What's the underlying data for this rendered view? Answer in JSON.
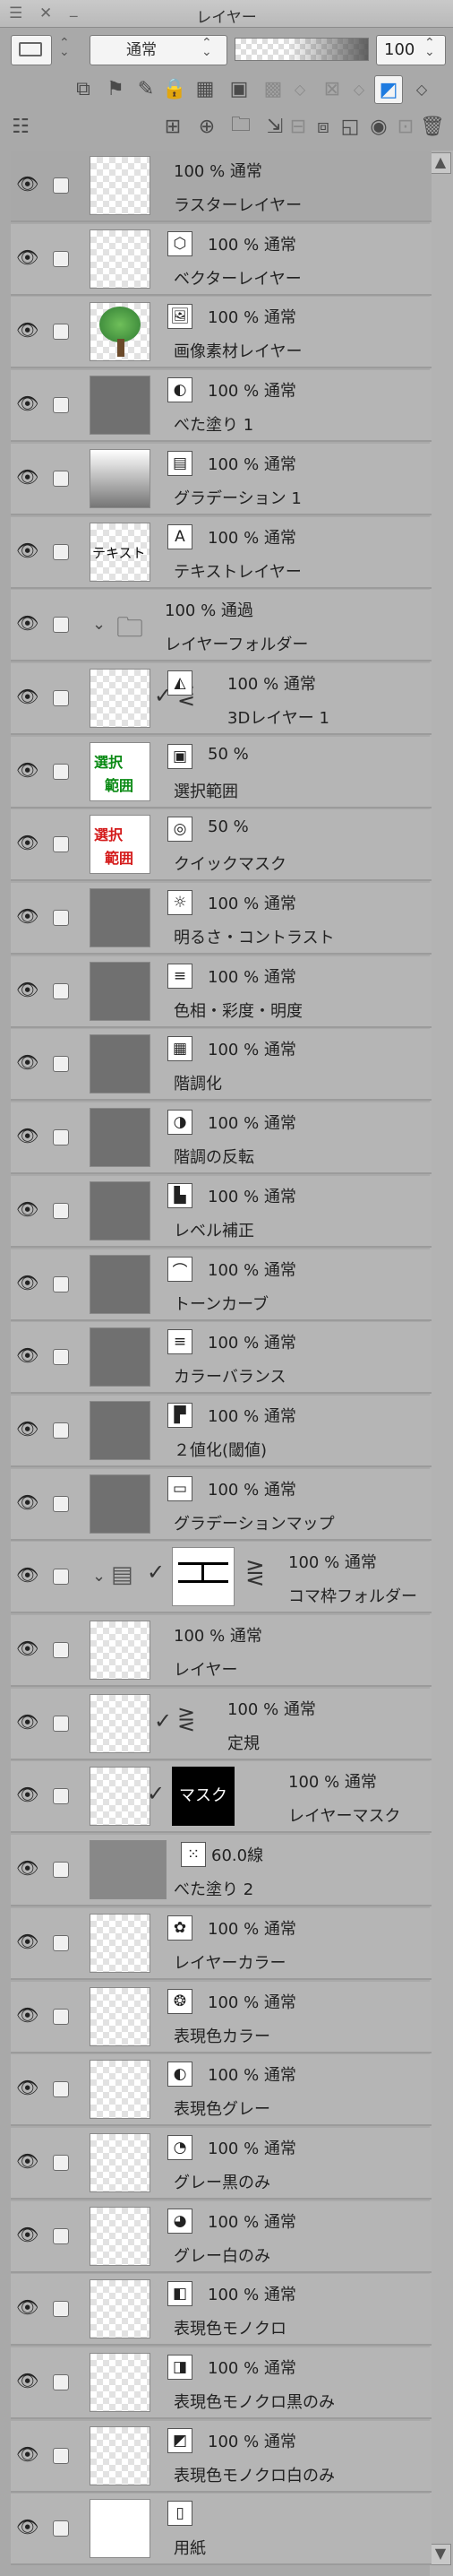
{
  "panel": {
    "title": "レイヤー"
  },
  "blend": {
    "mode": "通常",
    "opacity": "100"
  },
  "layers": [
    {
      "opacity": "100 %  通常",
      "name": "ラスターレイヤー",
      "thumb": "checker",
      "badge": ""
    },
    {
      "opacity": "100 %  通常",
      "name": "ベクターレイヤー",
      "thumb": "checker",
      "badge": "cube-icon"
    },
    {
      "opacity": "100 %  通常",
      "name": "画像素材レイヤー",
      "thumb": "tree",
      "badge": "image-icon"
    },
    {
      "opacity": "100 %  通常",
      "name": "べた塗り 1",
      "thumb": "gray",
      "badge": "fill-icon"
    },
    {
      "opacity": "100 %  通常",
      "name": "グラデーション 1",
      "thumb": "grad",
      "badge": "gradient-icon"
    },
    {
      "opacity": "100 %  通常",
      "name": "テキストレイヤー",
      "thumb": "text",
      "thumb_text": "テキスト",
      "badge": "text-icon"
    },
    {
      "opacity": "100 %  通過",
      "name": "レイヤーフォルダー",
      "thumb": "folder",
      "badge": ""
    },
    {
      "opacity": "100 %  通常",
      "name": "3Dレイヤー 1",
      "thumb": "checker",
      "badge": "3d-icon"
    },
    {
      "opacity": "50 %",
      "name": "選択範囲",
      "thumb": "sel",
      "thumb_text1": "選択",
      "thumb_text2": "範囲",
      "badge": "selection-icon"
    },
    {
      "opacity": "50 %",
      "name": "クイックマスク",
      "thumb": "qmask",
      "thumb_text1": "選択",
      "thumb_text2": "範囲",
      "badge": "quickmask-icon"
    },
    {
      "opacity": "100 %  通常",
      "name": "明るさ・コントラスト",
      "thumb": "gray",
      "badge": "brightness-icon"
    },
    {
      "opacity": "100 %  通常",
      "name": "色相・彩度・明度",
      "thumb": "gray",
      "badge": "hue-icon"
    },
    {
      "opacity": "100 %  通常",
      "name": "階調化",
      "thumb": "gray",
      "badge": "posterize-icon"
    },
    {
      "opacity": "100 %  通常",
      "name": "階調の反転",
      "thumb": "gray",
      "badge": "invert-icon"
    },
    {
      "opacity": "100 %  通常",
      "name": "レベル補正",
      "thumb": "gray",
      "badge": "levels-icon"
    },
    {
      "opacity": "100 %  通常",
      "name": "トーンカーブ",
      "thumb": "gray",
      "badge": "curve-icon"
    },
    {
      "opacity": "100 %  通常",
      "name": "カラーバランス",
      "thumb": "gray",
      "badge": "balance-icon"
    },
    {
      "opacity": "100 %  通常",
      "name": "２値化(閾値)",
      "thumb": "gray",
      "badge": "threshold-icon"
    },
    {
      "opacity": "100 %  通常",
      "name": "グラデーションマップ",
      "thumb": "gray",
      "badge": "gradmap-icon"
    },
    {
      "opacity": "100 %  通常",
      "name": "コマ枠フォルダー",
      "thumb": "frame",
      "badge": ""
    },
    {
      "opacity": "100 %  通常",
      "name": "レイヤー",
      "thumb": "checker",
      "badge": ""
    },
    {
      "opacity": "100 %  通常",
      "name": "定規",
      "thumb": "checker",
      "badge": ""
    },
    {
      "opacity": "100 %  通常",
      "name": "レイヤーマスク",
      "thumb": "mask",
      "thumb_text": "マスク",
      "badge": ""
    },
    {
      "opacity": "60.0線",
      "name": "べた塗り 2",
      "thumb": "mgray",
      "badge": "tone-icon"
    },
    {
      "opacity": "100 %  通常",
      "name": "レイヤーカラー",
      "thumb": "checker",
      "badge": "layercolor-icon"
    },
    {
      "opacity": "100 %  通常",
      "name": "表現色カラー",
      "thumb": "checker",
      "badge": "rgb-icon"
    },
    {
      "opacity": "100 %  通常",
      "name": "表現色グレー",
      "thumb": "checker",
      "badge": "gray-icon"
    },
    {
      "opacity": "100 %  通常",
      "name": "グレー黒のみ",
      "thumb": "checker",
      "badge": "grayblack-icon"
    },
    {
      "opacity": "100 %  通常",
      "name": "グレー白のみ",
      "thumb": "checker",
      "badge": "graywhite-icon"
    },
    {
      "opacity": "100 %  通常",
      "name": "表現色モノクロ",
      "thumb": "checker",
      "badge": "mono-icon"
    },
    {
      "opacity": "100 %  通常",
      "name": "表現色モノクロ黒のみ",
      "thumb": "checker",
      "badge": "monoblack-icon"
    },
    {
      "opacity": "100 %  通常",
      "name": "表現色モノクロ白のみ",
      "thumb": "checker",
      "badge": "monowhite-icon"
    },
    {
      "opacity": "",
      "name": "用紙",
      "thumb": "white",
      "badge": "paper-icon"
    }
  ]
}
